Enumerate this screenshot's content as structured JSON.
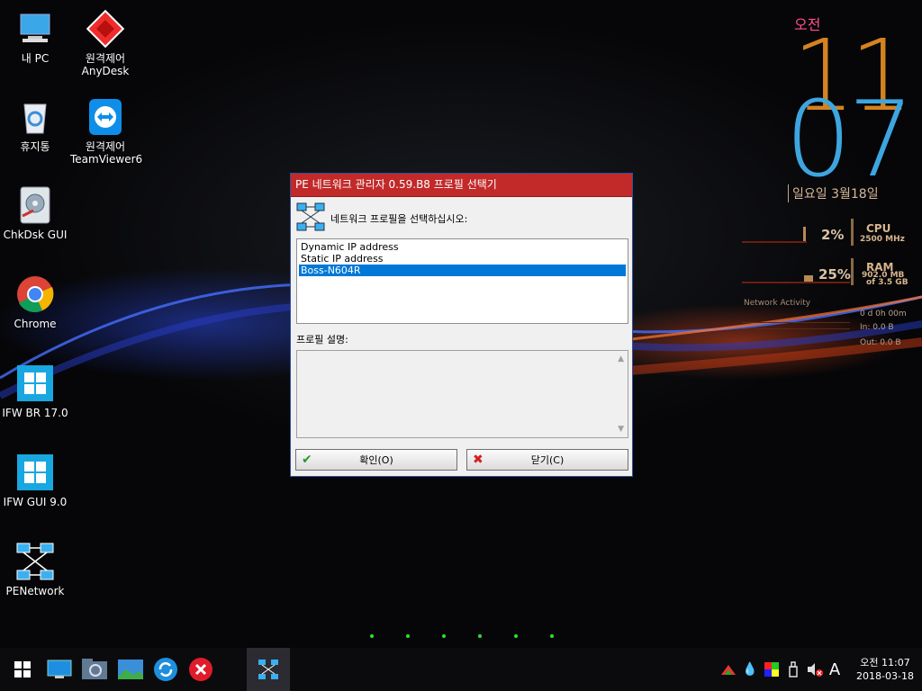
{
  "desktop": {
    "icons": [
      {
        "label": "내 PC"
      },
      {
        "label": "원격제어\nAnyDesk"
      },
      {
        "label": "휴지통"
      },
      {
        "label": "원격제어\nTeamViewer6"
      },
      {
        "label": "ChkDsk GUI"
      },
      {
        "label": "Chrome"
      },
      {
        "label": "IFW BR 17.0"
      },
      {
        "label": "IFW GUI 9.0"
      },
      {
        "label": "PENetwork"
      }
    ]
  },
  "clock_widget": {
    "ampm": "오전",
    "hour": "11",
    "minute": "07",
    "date": "일요일 3월18일",
    "cpu": {
      "percent": "2%",
      "title": "CPU",
      "sub": "2500 MHz",
      "level": 0.02
    },
    "ram": {
      "percent": "25%",
      "title": "RAM",
      "sub1": "902.0 MB",
      "sub2": "of  3.5 GB",
      "level": 0.25
    },
    "network": {
      "label": "Network Activity",
      "uptime": "0 d 0h 00m",
      "in": "In: 0.0 B",
      "out": "Out: 0.0 B"
    }
  },
  "dialog": {
    "title": "PE 네트워크 관리자 0.59.B8 프로필 선택기",
    "prompt": "네트워크 프로필을 선택하십시오:",
    "profiles": [
      {
        "name": "Dynamic IP address",
        "selected": false
      },
      {
        "name": "Static IP address",
        "selected": false
      },
      {
        "name": "Boss-N604R",
        "selected": true
      }
    ],
    "description_label": "프로필 설명:",
    "description_value": "",
    "ok_button": "확인(O)",
    "close_button": "닫기(C)",
    "colors": {
      "titlebar": "#c22a2a",
      "selection": "#0078d7"
    }
  },
  "taskbar": {
    "tray_keyboard": "A",
    "time": "오전 11:07",
    "date": "2018-03-18"
  }
}
